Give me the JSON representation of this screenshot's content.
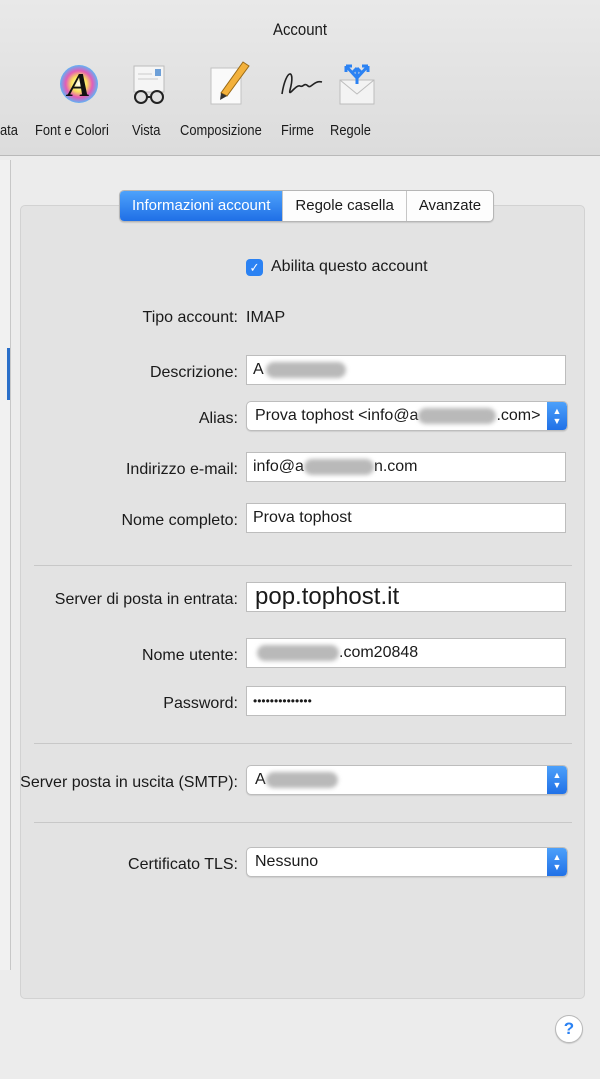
{
  "window": {
    "title": "Account"
  },
  "toolbar": {
    "items": [
      {
        "label": "ata",
        "icon": "partial-toolbar-item"
      },
      {
        "label": "Font e Colori",
        "icon": "font-colors-icon"
      },
      {
        "label": "Vista",
        "icon": "glasses-icon"
      },
      {
        "label": "Composizione",
        "icon": "compose-icon"
      },
      {
        "label": "Firme",
        "icon": "signature-icon"
      },
      {
        "label": "Regole",
        "icon": "rules-icon"
      }
    ]
  },
  "tabs": [
    {
      "label": "Informazioni account",
      "active": true
    },
    {
      "label": "Regole casella",
      "active": false
    },
    {
      "label": "Avanzate",
      "active": false
    }
  ],
  "account": {
    "enable_label": "Abilita questo account",
    "enabled": true,
    "type_label": "Tipo account:",
    "type_value": "IMAP",
    "description_label": "Descrizione:",
    "description_value": "A",
    "alias_label": "Alias:",
    "alias_value_start": "Prova tophost <info@a",
    "alias_value_end": ".com>",
    "email_label": "Indirizzo e-mail:",
    "email_value_start": "info@a",
    "email_value_end": "n.com",
    "fullname_label": "Nome completo:",
    "fullname_value": "Prova tophost"
  },
  "incoming": {
    "server_label": "Server di posta in entrata:",
    "server_value": "pop.tophost.it",
    "username_label": "Nome utente:",
    "username_value_end": ".com20848",
    "password_label": "Password:",
    "password_value": "••••••••••••••"
  },
  "outgoing": {
    "smtp_label": "Server posta in uscita (SMTP):",
    "smtp_value": "A"
  },
  "tls": {
    "label": "Certificato TLS:",
    "value": "Nessuno"
  },
  "help": {
    "label": "?"
  },
  "colors": {
    "accent": "#2b82f3",
    "tab_active": "#1f6fe6"
  }
}
